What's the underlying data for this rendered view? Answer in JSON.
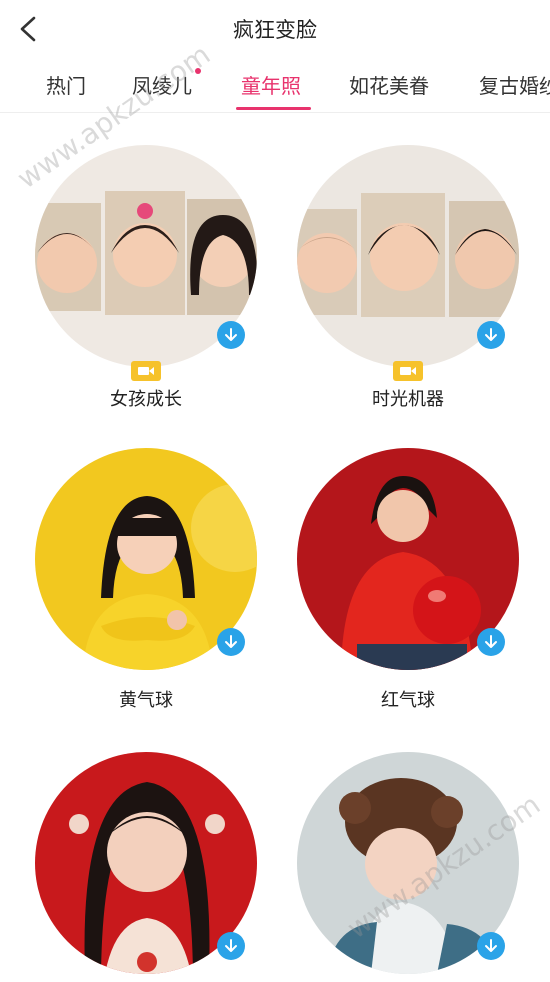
{
  "header": {
    "title": "疯狂变脸"
  },
  "tabs": [
    {
      "label": "热门",
      "active": false,
      "dot": false
    },
    {
      "label": "凤绫儿",
      "active": false,
      "dot": true
    },
    {
      "label": "童年照",
      "active": true,
      "dot": false
    },
    {
      "label": "如花美眷",
      "active": false,
      "dot": false
    },
    {
      "label": "复古婚纱",
      "active": false,
      "dot": false
    }
  ],
  "templates": [
    {
      "label": "女孩成长",
      "video": true,
      "bg": "#efe9e3",
      "icon": "download-icon"
    },
    {
      "label": "时光机器",
      "video": true,
      "bg": "#ece7e1",
      "icon": "download-icon"
    },
    {
      "label": "黄气球",
      "video": false,
      "bg": "#f2c81f",
      "icon": "download-icon"
    },
    {
      "label": "红气球",
      "video": false,
      "bg": "#b4161b",
      "icon": "download-icon"
    },
    {
      "label": "",
      "video": false,
      "bg": "#c8191c",
      "icon": "download-icon"
    },
    {
      "label": "",
      "video": false,
      "bg": "#cfd6d7",
      "icon": "download-icon"
    }
  ],
  "watermark": "www.apkzu.com",
  "colors": {
    "accent": "#e8336d",
    "download": "#2aa3e8",
    "video_badge": "#f6c22b"
  }
}
